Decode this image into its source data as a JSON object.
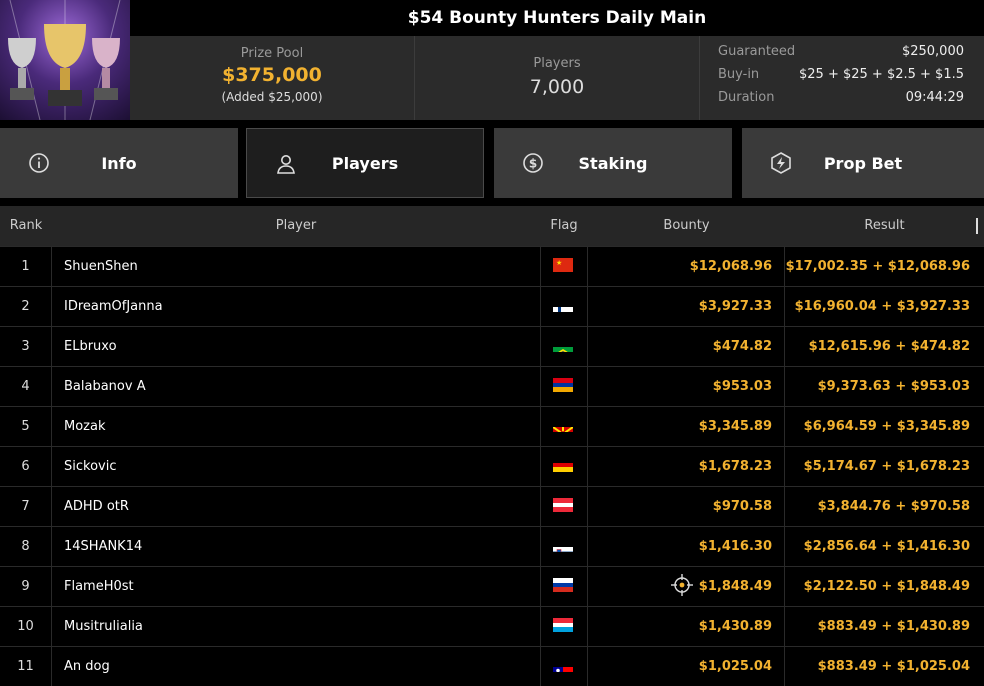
{
  "header": {
    "title": "$54 Bounty Hunters Daily Main",
    "prize_label": "Prize Pool",
    "prize_value": "$375,000",
    "prize_added": "(Added $25,000)",
    "players_label": "Players",
    "players_value": "7,000",
    "details": [
      {
        "key": "Guaranteed",
        "value": "$250,000"
      },
      {
        "key": "Buy-in",
        "value": "$25 + $25 + $2.5 + $1.5"
      },
      {
        "key": "Duration",
        "value": "09:44:29"
      }
    ]
  },
  "tabs": [
    {
      "label": "Info",
      "icon": "info-icon"
    },
    {
      "label": "Players",
      "icon": "user-icon",
      "active": true
    },
    {
      "label": "Staking",
      "icon": "dollar-icon"
    },
    {
      "label": "Prop Bet",
      "icon": "bolt-icon"
    }
  ],
  "table": {
    "headers": {
      "rank": "Rank",
      "player": "Player",
      "flag": "Flag",
      "bounty": "Bounty",
      "result": "Result"
    },
    "rows": [
      {
        "rank": "1",
        "player": "ShuenShen",
        "flag": "china",
        "bounty": "$12,068.96",
        "result": "$17,002.35 + $12,068.96"
      },
      {
        "rank": "2",
        "player": "IDreamOfJanna",
        "flag": "finland",
        "bounty": "$3,927.33",
        "result": "$16,960.04 + $3,927.33"
      },
      {
        "rank": "3",
        "player": "ELbruxo",
        "flag": "brazil",
        "bounty": "$474.82",
        "result": "$12,615.96 + $474.82"
      },
      {
        "rank": "4",
        "player": "Balabanov A",
        "flag": "armenia",
        "bounty": "$953.03",
        "result": "$9,373.63 + $953.03"
      },
      {
        "rank": "5",
        "player": "Mozak",
        "flag": "north-macedonia",
        "bounty": "$3,345.89",
        "result": "$6,964.59 + $3,345.89"
      },
      {
        "rank": "6",
        "player": "Sickovic",
        "flag": "germany",
        "bounty": "$1,678.23",
        "result": "$5,174.67 + $1,678.23"
      },
      {
        "rank": "7",
        "player": "ADHD otR",
        "flag": "austria",
        "bounty": "$970.58",
        "result": "$3,844.76 + $970.58"
      },
      {
        "rank": "8",
        "player": "14SHANK14",
        "flag": "slovenia",
        "bounty": "$1,416.30",
        "result": "$2,856.64 + $1,416.30"
      },
      {
        "rank": "9",
        "player": "FlameH0st",
        "flag": "russia",
        "bounty": "$1,848.49",
        "result": "$2,122.50 + $1,848.49",
        "target": true
      },
      {
        "rank": "10",
        "player": "Musitrulialia",
        "flag": "luxembourg",
        "bounty": "$1,430.89",
        "result": "$883.49 + $1,430.89"
      },
      {
        "rank": "11",
        "player": "An dog",
        "flag": "taiwan",
        "bounty": "$1,025.04",
        "result": "$883.49 + $1,025.04"
      }
    ]
  },
  "colors": {
    "accent": "#f2b230",
    "panel": "#2b2b2b",
    "tab": "#3a3a3a",
    "header_row": "#262626"
  }
}
